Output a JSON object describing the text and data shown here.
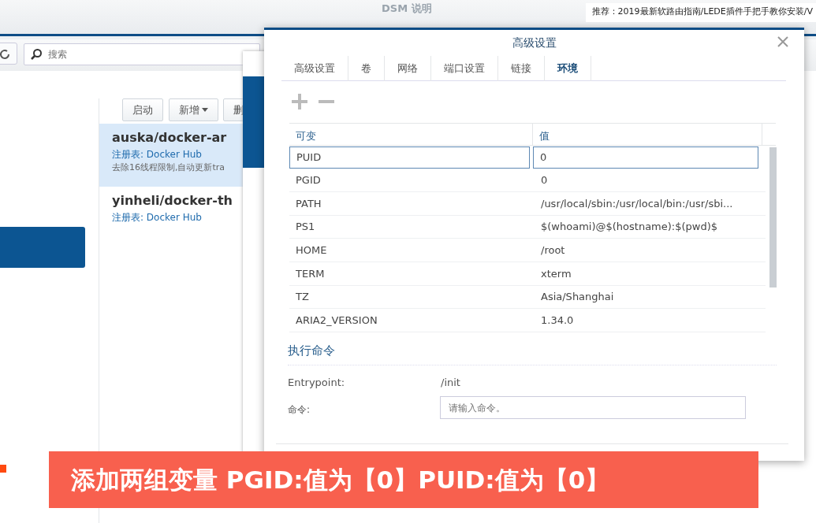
{
  "background_window": {
    "title": "DSM 说明"
  },
  "banner": {
    "text": "推荐：2019最新软路由指南/LEDE插件手把手教你安装/V"
  },
  "main_window": {
    "search": {
      "placeholder": "搜索"
    },
    "toolbar_buttons": [
      {
        "label": "启动",
        "kind": "plain"
      },
      {
        "label": "新增",
        "kind": "dropdown"
      },
      {
        "label": "删",
        "kind": "plain"
      }
    ],
    "images": [
      {
        "name": "auska/docker-ar",
        "registry": "注册表: Docker Hub",
        "description": "去除16线程限制,自动更新tra",
        "selected": true
      },
      {
        "name": "yinheli/docker-th",
        "registry": "注册表: Docker Hub",
        "selected": false
      }
    ]
  },
  "dialog": {
    "title": "高级设置",
    "tabs": [
      {
        "label": "高级设置",
        "selected": false
      },
      {
        "label": "卷",
        "selected": false
      },
      {
        "label": "网络",
        "selected": false
      },
      {
        "label": "端口设置",
        "selected": false
      },
      {
        "label": "链接",
        "selected": false
      },
      {
        "label": "环境",
        "selected": true
      }
    ],
    "table": {
      "columns": [
        "可变",
        "值"
      ],
      "rows": [
        {
          "name": "PUID",
          "value": "0",
          "editing": true
        },
        {
          "name": "PGID",
          "value": "0",
          "editing": false
        },
        {
          "name": "PATH",
          "value": "/usr/local/sbin:/usr/local/bin:/usr/sbi...",
          "editing": false
        },
        {
          "name": "PS1",
          "value": "$(whoami)@$(hostname):$(pwd)$",
          "editing": false
        },
        {
          "name": "HOME",
          "value": "/root",
          "editing": false
        },
        {
          "name": "TERM",
          "value": "xterm",
          "editing": false
        },
        {
          "name": "TZ",
          "value": "Asia/Shanghai",
          "editing": false
        },
        {
          "name": "ARIA2_VERSION",
          "value": "1.34.0",
          "editing": false
        }
      ]
    },
    "command_section": {
      "title": "执行命令",
      "entrypoint_label": "Entrypoint:",
      "entrypoint_value": "/init",
      "command_label": "命令:",
      "command_placeholder": "请输入命令。"
    }
  },
  "caption": {
    "text": "添加两组变量 PGID:值为【0】PUID:值为【0】"
  }
}
